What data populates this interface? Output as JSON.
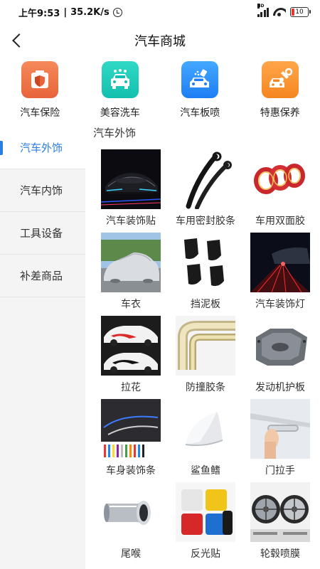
{
  "status_bar": {
    "time": "上午9:53",
    "speed": "35.2K/s",
    "separator": "|",
    "network": "HD",
    "battery": "10"
  },
  "nav": {
    "title": "汽车商城"
  },
  "top_categories": [
    {
      "label": "汽车保险",
      "icon": "insurance-shield-icon",
      "color": "#ee7446"
    },
    {
      "label": "美容洗车",
      "icon": "car-wash-icon",
      "color": "#22ccb8"
    },
    {
      "label": "汽车板喷",
      "icon": "car-spray-icon",
      "color": "#2d8ff8"
    },
    {
      "label": "特惠保养",
      "icon": "car-maintenance-icon",
      "color": "#f7902c"
    }
  ],
  "sidebar": {
    "items": [
      {
        "label": "汽车外饰",
        "active": true
      },
      {
        "label": "汽车内饰",
        "active": false
      },
      {
        "label": "工具设备",
        "active": false
      },
      {
        "label": "补差商品",
        "active": false
      }
    ]
  },
  "main": {
    "section_title": "汽车外饰",
    "products": [
      {
        "name": "汽车装饰贴",
        "image": "car-decal-image"
      },
      {
        "name": "车用密封胶条",
        "image": "seal-strip-image"
      },
      {
        "name": "车用双面胶",
        "image": "double-sided-tape-image"
      },
      {
        "name": "车衣",
        "image": "car-cover-image"
      },
      {
        "name": "挡泥板",
        "image": "mud-flap-image"
      },
      {
        "name": "汽车装饰灯",
        "image": "decor-light-image"
      },
      {
        "name": "拉花",
        "image": "car-sticker-stripe-image"
      },
      {
        "name": "防撞胶条",
        "image": "anti-collision-strip-image"
      },
      {
        "name": "发动机护板",
        "image": "engine-guard-image"
      },
      {
        "name": "车身装饰条",
        "image": "body-trim-strip-image"
      },
      {
        "name": "鲨鱼鳍",
        "image": "shark-fin-antenna-image"
      },
      {
        "name": "门拉手",
        "image": "door-handle-image"
      },
      {
        "name": "尾喉",
        "image": "exhaust-tip-image"
      },
      {
        "name": "反光贴",
        "image": "reflective-tape-image"
      },
      {
        "name": "轮毂喷膜",
        "image": "wheel-spray-film-image"
      }
    ]
  },
  "colors": {
    "accent": "#2a7de1",
    "sidebar_bg": "#f4f4f4"
  }
}
